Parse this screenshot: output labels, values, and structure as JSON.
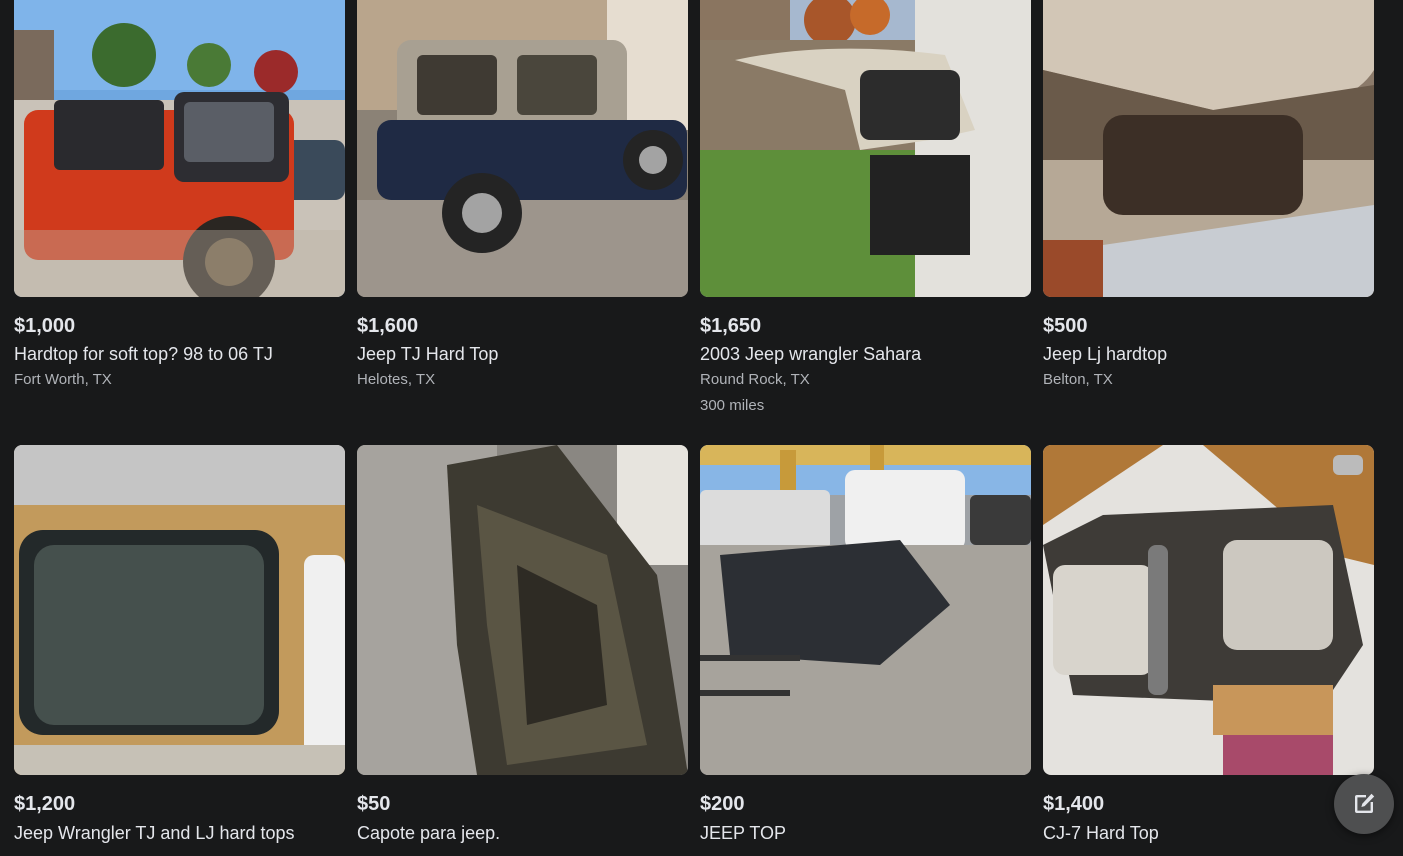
{
  "listings_row1": [
    {
      "price": "$1,000",
      "title": "Hardtop for soft top? 98 to 06 TJ",
      "location": "Fort Worth, TX"
    },
    {
      "price": "$1,600",
      "title": "Jeep TJ Hard Top",
      "location": "Helotes, TX"
    },
    {
      "price": "$1,650",
      "title": "2003 Jeep wrangler Sahara",
      "location": "Round Rock, TX",
      "miles": "300 miles"
    },
    {
      "price": "$500",
      "title": "Jeep Lj hardtop",
      "location": "Belton, TX"
    }
  ],
  "listings_row2": [
    {
      "price": "$1,200",
      "title": "Jeep Wrangler TJ and LJ hard tops"
    },
    {
      "price": "$50",
      "title": "Capote para jeep."
    },
    {
      "price": "$200",
      "title": "JEEP TOP"
    },
    {
      "price": "$1,400",
      "title": "CJ-7 Hard Top"
    }
  ],
  "compose_button": {
    "icon": "compose-icon"
  }
}
